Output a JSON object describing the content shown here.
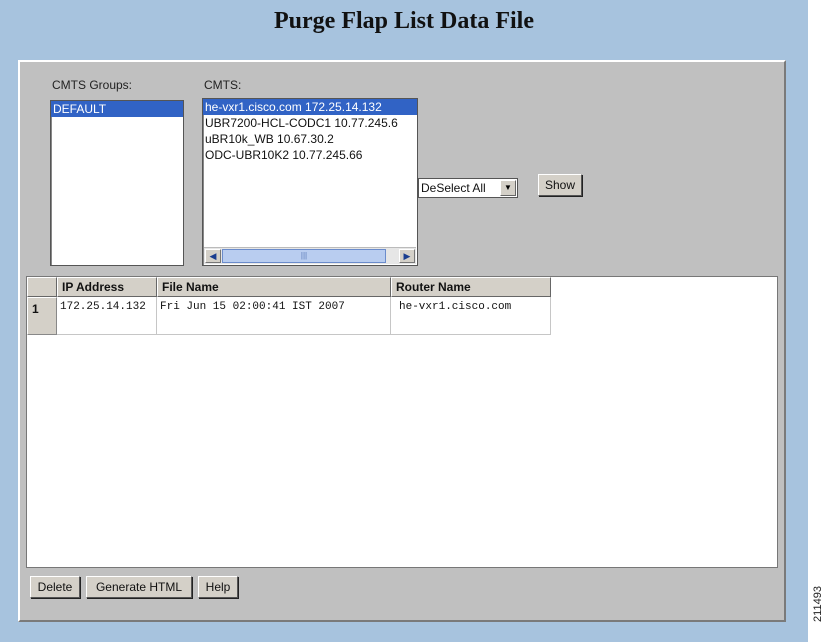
{
  "page": {
    "title": "Purge Flap List Data File"
  },
  "filters": {
    "groups_label": "CMTS Groups:",
    "cmts_label": "CMTS:",
    "groups": [
      "DEFAULT"
    ],
    "cmts": [
      "he-vxr1.cisco.com 172.25.14.132",
      "UBR7200-HCL-CODC1 10.77.245.6",
      "uBR10k_WB 10.67.30.2",
      "ODC-UBR10K2 10.77.245.66"
    ],
    "select_combo": "DeSelect All",
    "show_button": "Show"
  },
  "table": {
    "columns": [
      "IP Address",
      "File Name",
      "Router Name"
    ],
    "rows": [
      {
        "num": "1",
        "ip": "172.25.14.132",
        "file": "Fri Jun 15 02:00:41 IST 2007",
        "router": "he-vxr1.cisco.com"
      }
    ]
  },
  "footer": {
    "delete_button": "Delete",
    "generate_button": "Generate HTML",
    "help_button": "Help"
  },
  "figure_id": "211493"
}
